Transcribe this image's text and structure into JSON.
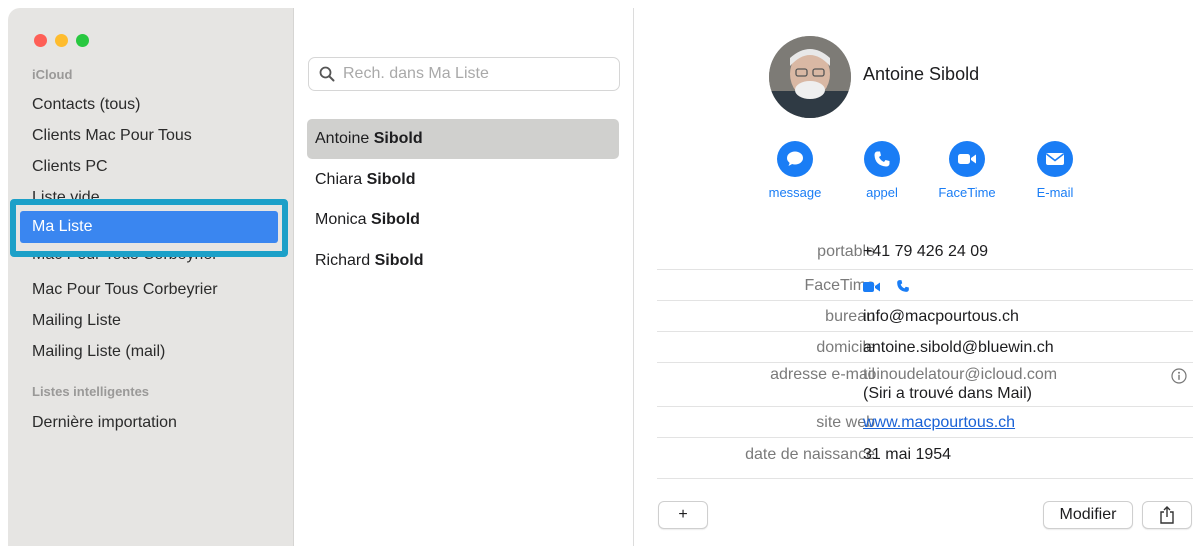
{
  "sidebar": {
    "section_icloud": "iCloud",
    "items": [
      "Contacts (tous)",
      "Clients Mac Pour Tous",
      "Clients PC",
      "Liste vide",
      "Ma Liste",
      "Mac Pour Tous Corbeyrier",
      "Mac Pour Tous Corbeyrier",
      "Mailing Liste",
      "Mailing Liste (mail)"
    ],
    "section_smart": "Listes intelligentes",
    "smart_items": [
      "Dernière importation"
    ]
  },
  "search": {
    "placeholder": "Rech. dans Ma Liste"
  },
  "contacts": [
    {
      "first": "Antoine",
      "last": "Sibold"
    },
    {
      "first": "Chiara",
      "last": "Sibold"
    },
    {
      "first": "Monica",
      "last": "Sibold"
    },
    {
      "first": "Richard",
      "last": "Sibold"
    }
  ],
  "detail": {
    "name": "Antoine Sibold",
    "actions": [
      "message",
      "appel",
      "FaceTime",
      "E-mail"
    ],
    "fields": {
      "mobile_label": "portable",
      "mobile_value": "+41 79 426 24 09",
      "facetime_label": "FaceTime",
      "work_label": "bureau",
      "work_value": "info@macpourtous.ch",
      "home_label": "domicile",
      "home_value": "antoine.sibold@bluewin.ch",
      "email_label": "adresse e-mail",
      "email_value": "toinoudelatour@icloud.com",
      "email_note": "(Siri a trouvé dans Mail)",
      "web_label": "site web",
      "web_value": "www.macpourtous.ch",
      "birthday_label": "date de naissance",
      "birthday_value": "31 mai 1954"
    },
    "add_label": "+",
    "edit_label": "Modifier"
  },
  "colors": {
    "accent": "#1a7df5",
    "selection": "#3a86f0",
    "highlight_box": "#1ca0c8"
  }
}
